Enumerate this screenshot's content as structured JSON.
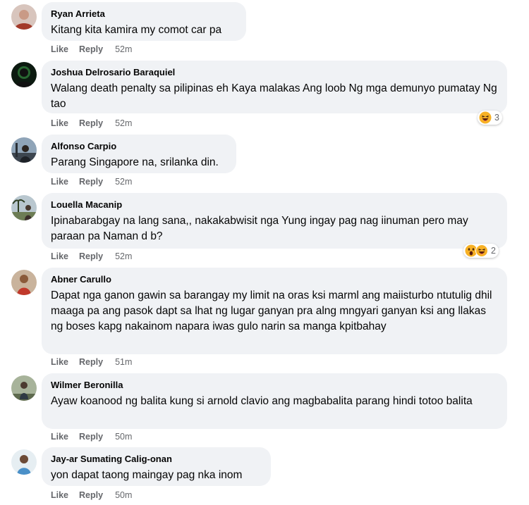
{
  "comments": [
    {
      "author": "Ryan Arrieta",
      "text": "Kitang kita kamira my comot car pa",
      "like": "Like",
      "reply": "Reply",
      "time": "52m",
      "avatar_color": "#c9a79a"
    },
    {
      "author": "Joshua Delrosario Baraquiel",
      "text": "Walang death penalty sa pilipinas eh Kaya malakas Ang loob Ng mga demunyo pumatay Ng tao",
      "like": "Like",
      "reply": "Reply",
      "time": "52m",
      "reaction_count": "3",
      "reaction_icons": [
        "haha-emoji-icon"
      ],
      "avatar_color": "#1a1a1a"
    },
    {
      "author": "Alfonso Carpio",
      "text": "Parang Singapore na, srilanka din.",
      "like": "Like",
      "reply": "Reply",
      "time": "52m",
      "avatar_color": "#6f7f91"
    },
    {
      "author": "Louella Macanip",
      "text": "Ipinabarabgay na lang sana,, nakakabwisit nga Yung ingay pag nag iinuman pero may paraan pa Naman d b?",
      "like": "Like",
      "reply": "Reply",
      "time": "52m",
      "reaction_count": "2",
      "reaction_icons": [
        "wow-emoji-icon",
        "haha-emoji-icon"
      ],
      "avatar_color": "#7a8a6a"
    },
    {
      "author": "Abner Carullo",
      "text": "Dapat nga ganon gawin sa barangay my limit na oras ksi marml ang maiisturbo ntutulig dhil maaga pa ang pasok dapt sa lhat ng lugar ganyan pra alng mngyari ganyan ksi ang llakas ng boses kapg nakainom napara iwas gulo narin sa manga kpitbahay",
      "like": "Like",
      "reply": "Reply",
      "time": "51m",
      "avatar_color": "#b08a6a"
    },
    {
      "author": "Wilmer Beronilla",
      "text": "Ayaw koanood ng balita kung si arnold clavio ang magbabalita parang hindi totoo balita",
      "like": "Like",
      "reply": "Reply",
      "time": "50m",
      "avatar_color": "#5c6b55"
    },
    {
      "author": "Jay-ar Sumating Calig-onan",
      "text": "yon dapat taong maingay pag nka inom",
      "like": "Like",
      "reply": "Reply",
      "time": "50m",
      "avatar_color": "#9fb3c0"
    }
  ]
}
